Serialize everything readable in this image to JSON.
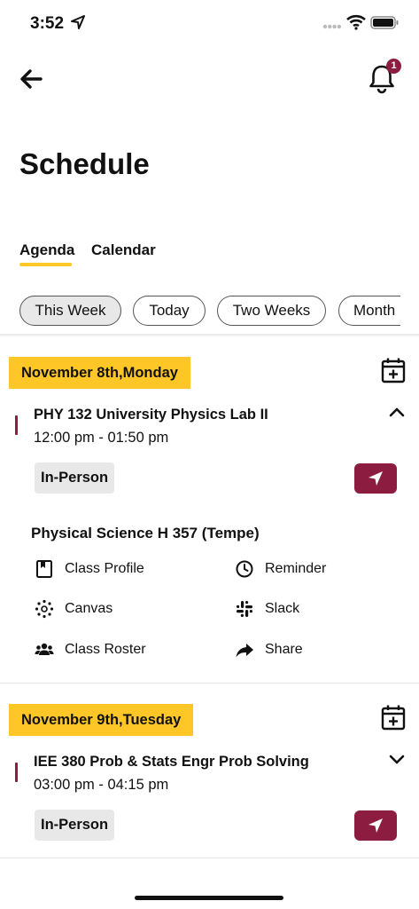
{
  "status_bar": {
    "time": "3:52",
    "icons": [
      "location-arrow-icon",
      "signal-dots-icon",
      "wifi-icon",
      "battery-icon"
    ]
  },
  "header": {
    "notification_count": "1",
    "title": "Schedule"
  },
  "tabs": [
    {
      "label": "Agenda",
      "active": true
    },
    {
      "label": "Calendar",
      "active": false
    }
  ],
  "filters": [
    {
      "label": "This Week",
      "selected": true
    },
    {
      "label": "Today",
      "selected": false
    },
    {
      "label": "Two Weeks",
      "selected": false
    },
    {
      "label": "Month",
      "selected": false
    }
  ],
  "days": [
    {
      "date": "November 8th,Monday",
      "expanded": true,
      "class": {
        "title": "PHY 132 University Physics Lab II",
        "time": "12:00 pm - 01:50 pm",
        "mode": "In-Person",
        "location": "Physical Science H 357 (Tempe)"
      },
      "actions": [
        {
          "label": "Class Profile",
          "icon": "bookmark-book-icon"
        },
        {
          "label": "Reminder",
          "icon": "clock-icon"
        },
        {
          "label": "Canvas",
          "icon": "canvas-icon"
        },
        {
          "label": "Slack",
          "icon": "slack-icon"
        },
        {
          "label": "Class Roster",
          "icon": "people-icon"
        },
        {
          "label": "Share",
          "icon": "share-arrow-icon"
        }
      ]
    },
    {
      "date": "November 9th,Tuesday",
      "expanded": false,
      "class": {
        "title": "IEE 380 Prob & Stats Engr Prob Solving",
        "time": "03:00 pm - 04:15 pm",
        "mode": "In-Person"
      }
    }
  ],
  "colors": {
    "maroon": "#8c1d40",
    "gold": "#ffc627",
    "chip_selected": "#e8e8e8"
  }
}
